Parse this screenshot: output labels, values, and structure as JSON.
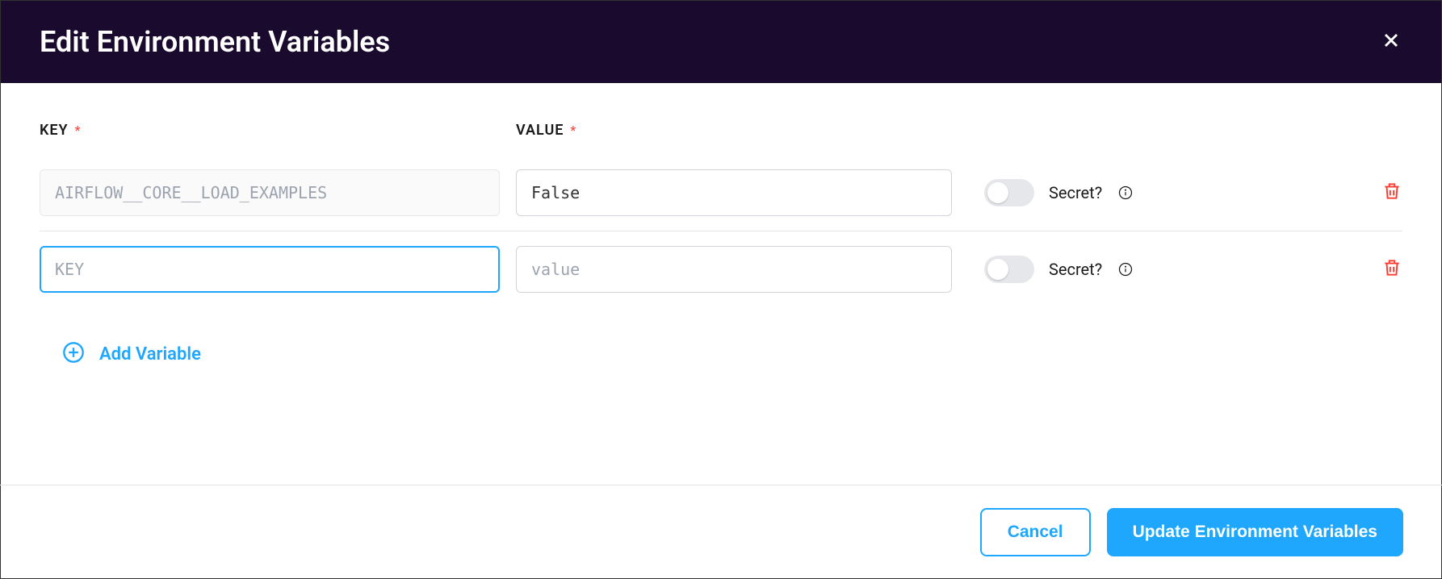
{
  "header": {
    "title": "Edit Environment Variables"
  },
  "columns": {
    "key_label": "KEY",
    "value_label": "VALUE",
    "required_mark": "*"
  },
  "rows": [
    {
      "key_value": "AIRFLOW__CORE__LOAD_EXAMPLES",
      "value_value": "False",
      "secret_label": "Secret?"
    },
    {
      "key_placeholder": "KEY",
      "value_placeholder": "value",
      "secret_label": "Secret?"
    }
  ],
  "add_variable_label": "Add Variable",
  "footer": {
    "cancel_label": "Cancel",
    "submit_label": "Update Environment Variables"
  }
}
